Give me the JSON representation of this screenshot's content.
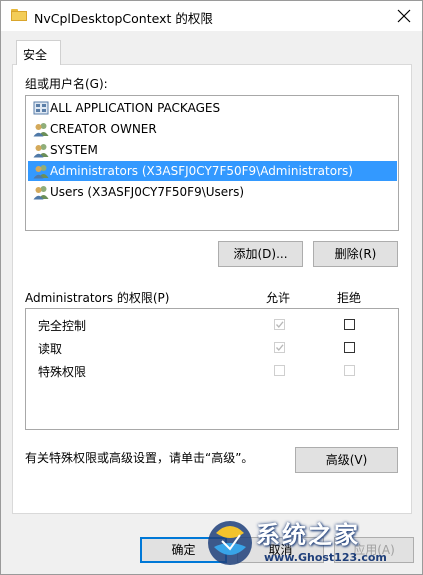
{
  "window": {
    "title": "NvCplDesktopContext 的权限"
  },
  "tabs": [
    {
      "label": "安全"
    }
  ],
  "groups": {
    "label": "组或用户名(G):",
    "items": [
      {
        "label": "ALL APPLICATION PACKAGES",
        "icon": "app-packages-icon",
        "selected": false
      },
      {
        "label": "CREATOR OWNER",
        "icon": "users-icon",
        "selected": false
      },
      {
        "label": "SYSTEM",
        "icon": "users-icon",
        "selected": false
      },
      {
        "label": "Administrators (X3ASFJ0CY7F50F9\\Administrators)",
        "icon": "users-icon",
        "selected": true
      },
      {
        "label": "Users (X3ASFJ0CY7F50F9\\Users)",
        "icon": "users-icon",
        "selected": false
      }
    ]
  },
  "buttons": {
    "add": "添加(D)...",
    "remove": "删除(R)",
    "advanced": "高级(V)",
    "ok": "确定",
    "cancel": "取消",
    "apply": "应用(A)"
  },
  "permissions": {
    "label": "Administrators 的权限(P)",
    "allow_header": "允许",
    "deny_header": "拒绝",
    "rows": [
      {
        "name": "完全控制",
        "allow": true,
        "allow_enabled": false,
        "deny": false,
        "deny_enabled": true
      },
      {
        "name": "读取",
        "allow": true,
        "allow_enabled": false,
        "deny": false,
        "deny_enabled": true
      },
      {
        "name": "特殊权限",
        "allow": false,
        "allow_enabled": false,
        "deny": false,
        "deny_enabled": false
      }
    ]
  },
  "advanced_note": "有关特殊权限或高级设置，请单击“高级”。",
  "watermark": {
    "brand": "系统之家",
    "url": "www.Ghost123.com"
  },
  "colors": {
    "selection": "#3399ff",
    "primary_border": "#0078d7",
    "folder": "#f3cd58"
  }
}
